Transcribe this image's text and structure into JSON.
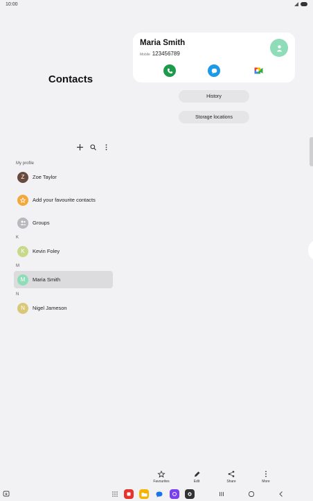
{
  "status_bar": {
    "time": "10:00"
  },
  "left_panel": {
    "title": "Contacts",
    "sections": {
      "my_profile": "My profile",
      "k": "K",
      "m": "M",
      "n": "N"
    },
    "items": [
      {
        "label": "Zoe Taylor",
        "avatar_letter": "Z",
        "avatar_color": "#6b4a3e"
      },
      {
        "label": "Add your favourite contacts",
        "avatar_letter": "",
        "avatar_color": "#f3a83b"
      },
      {
        "label": "Groups",
        "avatar_letter": "",
        "avatar_color": "#b8b8bd"
      },
      {
        "label": "Kevin Foley",
        "avatar_letter": "K",
        "avatar_color": "#c7d98a"
      },
      {
        "label": "Maria Smith",
        "avatar_letter": "M",
        "avatar_color": "#8fdcb8"
      },
      {
        "label": "Nigel Jameson",
        "avatar_letter": "N",
        "avatar_color": "#d8c878"
      }
    ]
  },
  "contact_card": {
    "name": "Maria Smith",
    "phone_label": "Mobile",
    "phone": "123456789"
  },
  "buttons": {
    "history": "History",
    "storage": "Storage locations"
  },
  "bottom_bar": {
    "favourites": "Favourites",
    "edit": "Edit",
    "share": "Share",
    "more": "More"
  },
  "colors": {
    "call": "#1d9a4c",
    "message": "#1a9ae8",
    "accent_avatar": "#8fdcb8"
  }
}
